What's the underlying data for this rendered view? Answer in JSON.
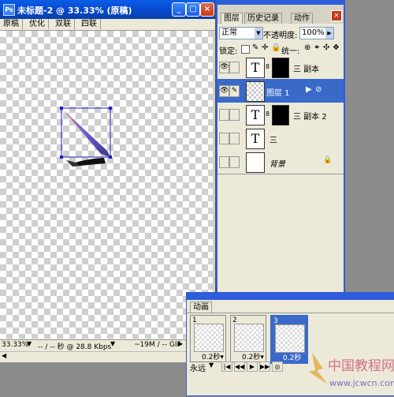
{
  "document": {
    "title": "未标题-2 @ 33.33% (原稿)",
    "view_tabs": [
      "原稿",
      "优化",
      "双联",
      "四联"
    ],
    "status": {
      "zoom": "33.33%",
      "timing": "-- / -- 秒 @ 28.8 Kbps",
      "size": "~19M / -- GIF"
    }
  },
  "layers_panel": {
    "tabs": [
      "图层",
      "历史记录",
      "动作"
    ],
    "active_tab": "图层",
    "blend_mode": "正常",
    "opacity_label": "不透明度:",
    "opacity_value": "100%",
    "lock_label": "锁定:",
    "unify_label": "统一:",
    "layers": [
      {
        "name": "三 副本",
        "type": "text",
        "has_mask": true,
        "visible": true,
        "selected": false
      },
      {
        "name": "图层 1",
        "type": "pixel",
        "has_mask": false,
        "visible": true,
        "selected": true
      },
      {
        "name": "三 副本 2",
        "type": "text",
        "has_mask": true,
        "visible": false,
        "selected": false
      },
      {
        "name": "三",
        "type": "text",
        "has_mask": false,
        "visible": false,
        "selected": false
      },
      {
        "name": "背景",
        "type": "background",
        "has_mask": false,
        "visible": false,
        "selected": false
      }
    ],
    "text_thumb_glyph": "T",
    "lock_glyph": "🔒"
  },
  "animation_panel": {
    "tab": "动画",
    "frames": [
      {
        "number": "1",
        "delay": "0.2秒▾"
      },
      {
        "number": "2",
        "delay": "0.2秒▾"
      },
      {
        "number": "3",
        "delay": "0.2秒"
      }
    ],
    "active_frame": "3",
    "loop": "永远"
  },
  "watermark": {
    "text_cn": "中国教程网",
    "url": "www.jcwcn.com"
  },
  "colors": {
    "title_blue": "#0747c6",
    "selection_blue": "#3a6ac9",
    "panel_bg": "#ece9d8"
  }
}
